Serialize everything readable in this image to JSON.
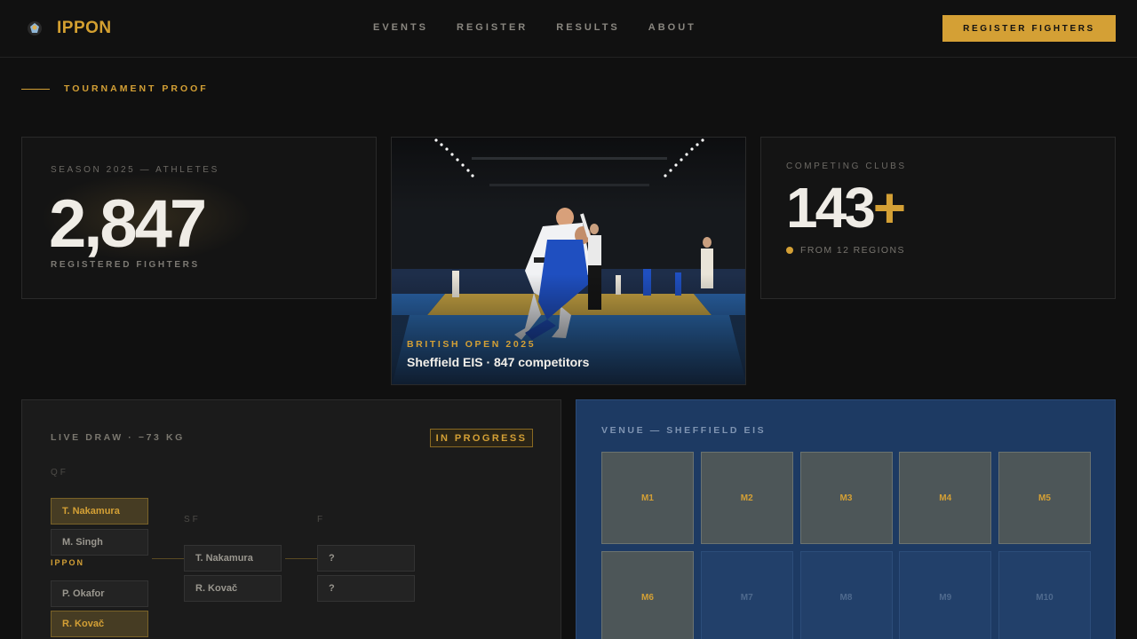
{
  "brand": {
    "name": "IPPON",
    "logo_icon": "fighter-mascot-icon",
    "accent": "#d4a035"
  },
  "nav": {
    "items": [
      "EVENTS",
      "REGISTER",
      "RESULTS",
      "ABOUT"
    ]
  },
  "header": {
    "cta_label": "REGISTER FIGHTERS"
  },
  "section": {
    "eyebrow": "TOURNAMENT PROOF"
  },
  "athletes": {
    "label": "SEASON 2025 — ATHLETES",
    "value": "2,847",
    "sub": "REGISTERED FIGHTERS"
  },
  "feature": {
    "kicker": "BRITISH OPEN 2025",
    "title": "Sheffield EIS · 847 competitors"
  },
  "clubs": {
    "label": "COMPETING CLUBS",
    "value": "143",
    "suffix": "+",
    "meta": "FROM 12 REGIONS"
  },
  "draw": {
    "title": "LIVE DRAW · −73 KG",
    "status": "IN PROGRESS",
    "rounds": {
      "qf": "QF",
      "sf": "SF",
      "f": "F"
    },
    "qf": [
      "T. Nakamura",
      "M. Singh",
      "P. Okafor",
      "R. Kovač"
    ],
    "result_tag": "IPPON",
    "sf": [
      "T. Nakamura",
      "R. Kovač"
    ],
    "final": [
      "?",
      "?"
    ]
  },
  "venue": {
    "title": "VENUE — SHEFFIELD EIS",
    "mats": [
      {
        "label": "M1",
        "active": true
      },
      {
        "label": "M2",
        "active": true
      },
      {
        "label": "M3",
        "active": true
      },
      {
        "label": "M4",
        "active": true
      },
      {
        "label": "M5",
        "active": true
      },
      {
        "label": "M6",
        "active": true
      },
      {
        "label": "M7",
        "active": false
      },
      {
        "label": "M8",
        "active": false
      },
      {
        "label": "M9",
        "active": false
      },
      {
        "label": "M10",
        "active": false
      }
    ]
  }
}
